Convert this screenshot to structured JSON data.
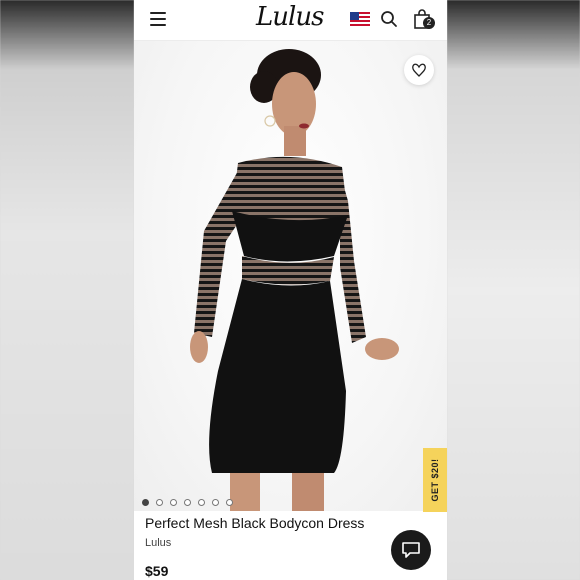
{
  "header": {
    "logo": "Lulus",
    "bag_count": "2"
  },
  "icons": [
    "hamburger-menu-icon",
    "us-flag-icon",
    "search-icon",
    "shopping-bag-icon",
    "heart-icon",
    "chat-icon"
  ],
  "gallery": {
    "image_count": 7,
    "active_index": 0
  },
  "promo": {
    "label": "GET $20!"
  },
  "product": {
    "title": "Perfect Mesh Black Bodycon Dress",
    "brand": "Lulus",
    "price": "$59"
  },
  "colors": {
    "promo_tab": "#f5d35b",
    "chat_button": "#1a1a1a",
    "dress": "#111111"
  }
}
